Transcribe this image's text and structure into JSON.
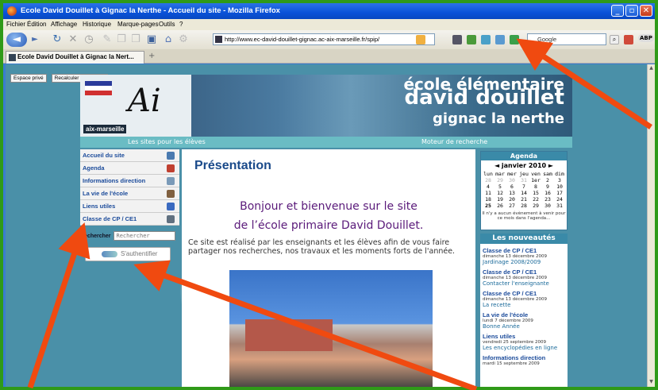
{
  "window": {
    "title": "Ecole David Douillet à Gignac la Nerthe - Accueil du site - Mozilla Firefox",
    "controls": [
      "_",
      "▫",
      "✕"
    ]
  },
  "menubar": [
    "Fichier",
    "Édition",
    "Affichage",
    "Historique",
    "Marque-pages",
    "Outils",
    "?"
  ],
  "toolbar": {
    "url": "http://www.ec-david-douillet-gignac.ac-aix-marseille.fr/spip/",
    "search_placeholder": "Google",
    "abp_label": "ABP"
  },
  "tab": {
    "label": "Ecole David Douillet à Gignac la Nert...",
    "new_tab": "+"
  },
  "page": {
    "buttons": [
      "Espace privé",
      "Recalculer cette page"
    ],
    "header": {
      "logo_text": "aix-marseille",
      "logo_letter": "Ai",
      "line1": "école élémentaire",
      "line2": "david douillet",
      "line3": "gignac la nerthe"
    },
    "nav": {
      "left": "Les sites pour les élèves",
      "right": "Moteur de recherche"
    },
    "sidebar": {
      "items": [
        {
          "label": "Accueil du site",
          "color": "#4a7ab0"
        },
        {
          "label": "Agenda",
          "color": "#c04030"
        },
        {
          "label": "Informations direction",
          "color": "#7a9ab8"
        },
        {
          "label": "La vie de l'école",
          "color": "#806040"
        },
        {
          "label": "Liens utiles",
          "color": "#3a6ac0"
        },
        {
          "label": "Classe de CP / CE1",
          "color": "#607080"
        }
      ],
      "search_label": "Rechercher",
      "search_placeholder": "Rechercher",
      "auth_label": "S'authentifier"
    },
    "content": {
      "title": "Présentation",
      "welcome1": "Bonjour et bienvenue sur le site",
      "welcome2": "de l’école primaire David Douillet.",
      "intro": "Ce site est réalisé par les enseignants et les élèves afin de vous faire partager nos recherches, nos travaux et les moments forts de l'année."
    },
    "agenda": {
      "title": "Agenda",
      "month": "◄  janvier 2010  ►",
      "days": [
        "lun",
        "mar",
        "mer",
        "jeu",
        "ven",
        "sam",
        "dim"
      ],
      "weeks": [
        [
          "28",
          "29",
          "30",
          "31",
          "1er",
          "2",
          "3"
        ],
        [
          "4",
          "5",
          "6",
          "7",
          "8",
          "9",
          "10"
        ],
        [
          "11",
          "12",
          "13",
          "14",
          "15",
          "16",
          "17"
        ],
        [
          "18",
          "19",
          "20",
          "21",
          "22",
          "23",
          "24"
        ],
        [
          "25",
          "26",
          "27",
          "28",
          "29",
          "30",
          "31"
        ]
      ],
      "note": "Il n'y a aucun évènement à venir pour ce mois dans l'agenda..."
    },
    "news": {
      "title": "Les nouveautés",
      "items": [
        {
          "section": "Classe de CP / CE1",
          "date": "dimanche 13 décembre 2009",
          "subject": "Jardinage 2008/2009"
        },
        {
          "section": "Classe de CP / CE1",
          "date": "dimanche 13 décembre 2009",
          "subject": "Contacter l'enseignante"
        },
        {
          "section": "Classe de CP / CE1",
          "date": "dimanche 13 décembre 2009",
          "subject": "La recette"
        },
        {
          "section": "La vie de l'école",
          "date": "lundi 7 décembre 2009",
          "subject": "Bonne Année"
        },
        {
          "section": "Liens utiles",
          "date": "vendredi 25 septembre 2009",
          "subject": "Les encyclopédies en ligne"
        },
        {
          "section": "Informations direction",
          "date": "mardi 15 septembre 2009",
          "subject": ""
        }
      ]
    }
  }
}
